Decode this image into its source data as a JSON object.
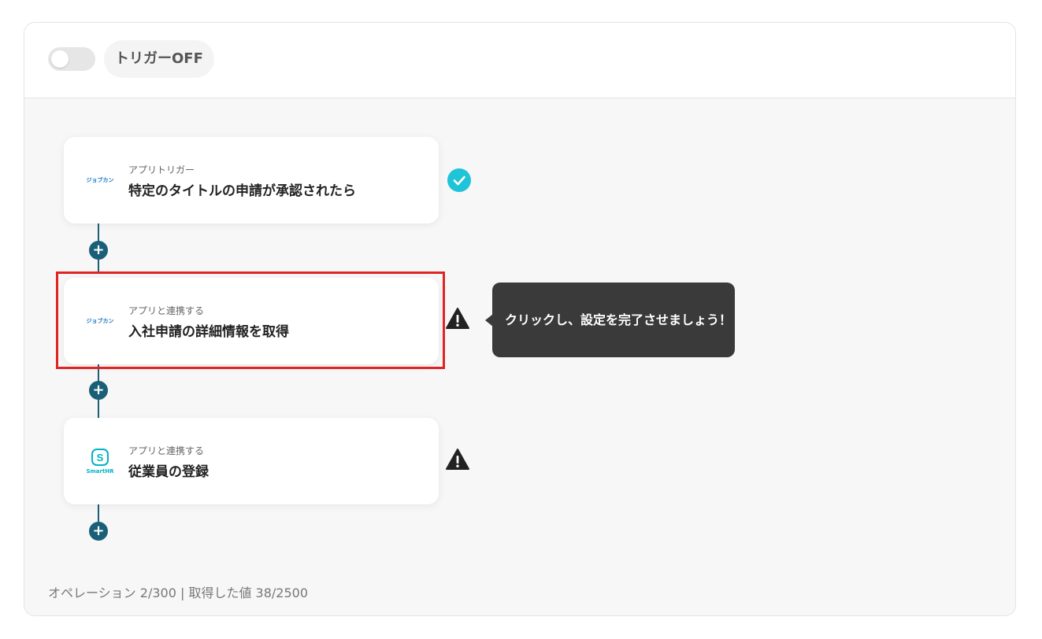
{
  "header": {
    "toggle_on": false,
    "trigger_label": "トリガーOFF"
  },
  "steps": [
    {
      "app_logo_text": "ジョブカン",
      "subtitle": "アプリトリガー",
      "title": "特定のタイトルの申請が承認されたら",
      "status": "complete",
      "status_icon": "check-circle-icon",
      "status_color": "#1fc4d8"
    },
    {
      "app_logo_text": "ジョブカン",
      "subtitle": "アプリと連携する",
      "title": "入社申請の詳細情報を取得",
      "status": "warning",
      "status_icon": "warning-icon",
      "highlighted": true
    },
    {
      "app_logo_text": "SmartHR",
      "subtitle": "アプリと連携する",
      "title": "従業員の登録",
      "status": "warning",
      "status_icon": "warning-icon"
    }
  ],
  "tooltip": {
    "text": "クリックし、設定を完了させましょう！"
  },
  "add_step_icon": "plus-icon",
  "footer": {
    "stats": "オペレーション 2/300 | 取得した値 38/2500"
  },
  "colors": {
    "connector": "#1a5f78",
    "highlight_border": "#e02424",
    "tooltip_bg": "#3a3a3a",
    "jobcan_blue": "#1a78c2",
    "smarthr_teal": "#00b3c7"
  }
}
